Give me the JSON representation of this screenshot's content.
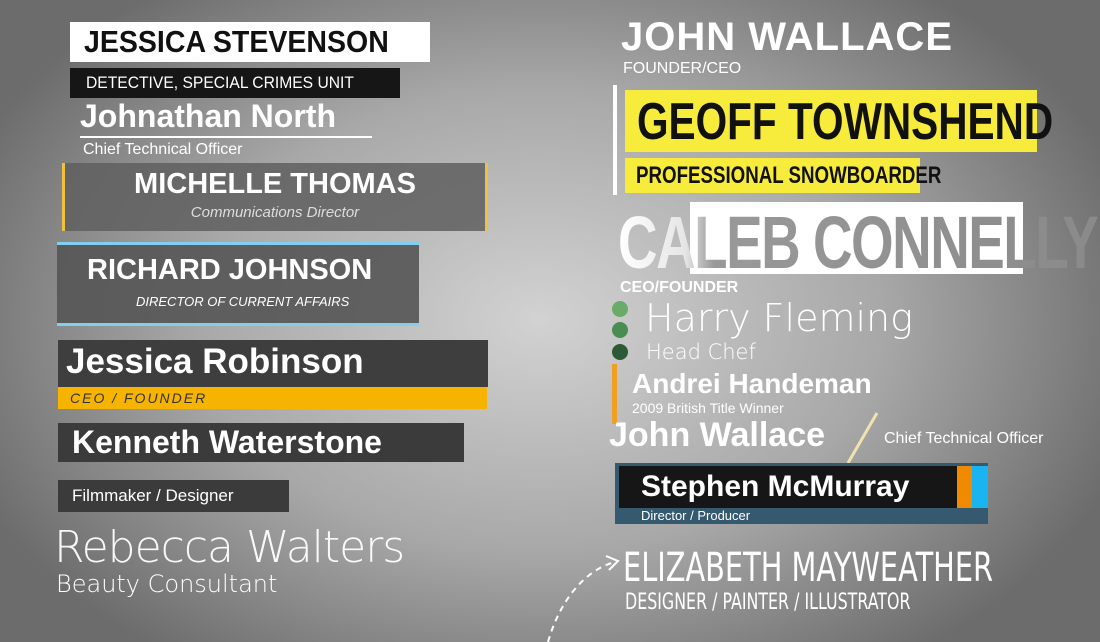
{
  "left": {
    "jessica_stevenson": {
      "name": "JESSICA STEVENSON",
      "title": "DETECTIVE, SPECIAL CRIMES UNIT"
    },
    "johnathan_north": {
      "name": "Johnathan North",
      "title": "Chief Technical Officer"
    },
    "michelle_thomas": {
      "name": "MICHELLE THOMAS",
      "title": "Communications Director"
    },
    "richard_johnson": {
      "name": "RICHARD JOHNSON",
      "title": "DIRECTOR OF CURRENT AFFAIRS"
    },
    "jessica_robinson": {
      "name": "Jessica Robinson",
      "title": "CEO / FOUNDER"
    },
    "kenneth_waterstone": {
      "name": "Kenneth Waterstone"
    },
    "filmmaker": {
      "title": "Filmmaker / Designer"
    },
    "rebecca_walters": {
      "name": "Rebecca Walters",
      "title": "Beauty Consultant"
    }
  },
  "right": {
    "john_wallace_1": {
      "name": "JOHN WALLACE",
      "title": "FOUNDER/CEO"
    },
    "geoff_townshend": {
      "name": "GEOFF TOWNSHEND",
      "title": "PROFESSIONAL SNOWBOARDER"
    },
    "caleb_connelly": {
      "name": "CALEB CONNELLY",
      "title": "CEO/FOUNDER"
    },
    "harry_fleming": {
      "name": "Harry Fleming",
      "title": "Head Chef"
    },
    "andrei_handeman": {
      "name": "Andrei Handeman",
      "title": "2009 British Title Winner"
    },
    "john_wallace_2": {
      "name": "John Wallace",
      "title": "Chief Technical Officer"
    },
    "stephen_mcmurray": {
      "name": "Stephen McMurray",
      "title": "Director / Producer"
    },
    "elizabeth_mayweather": {
      "name": "ELIZABETH MAYWEATHER",
      "title": "DESIGNER / PAINTER / ILLUSTRATOR"
    }
  },
  "colors": {
    "yellow": "#f6b400",
    "bright_yellow": "#f7ec3c",
    "blue_line": "#7fd0ef",
    "orange": "#f08a00",
    "cyan": "#1ab4f0",
    "teal_bar": "#355a70"
  }
}
